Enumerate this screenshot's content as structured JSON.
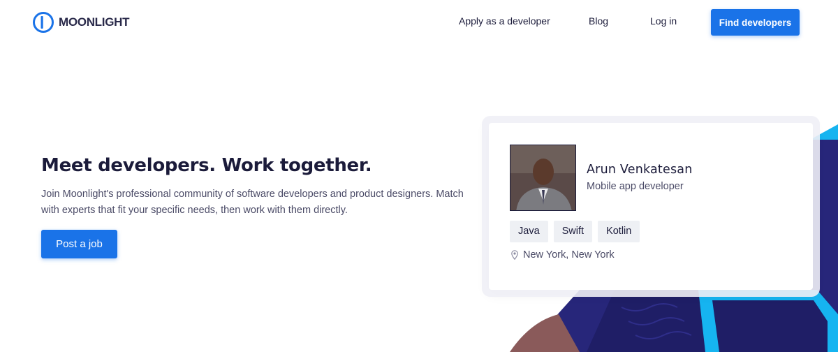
{
  "brand": {
    "name": "MOONLIGHT",
    "color": "#1a73e8"
  },
  "nav": {
    "apply": "Apply as a developer",
    "blog": "Blog",
    "login": "Log in",
    "find": "Find developers"
  },
  "hero": {
    "title": "Meet developers. Work together.",
    "subtitle": "Join Moonlight's professional community of software developers and product designers. Match with experts that fit your specific needs, then work with them directly.",
    "cta": "Post a job"
  },
  "profile": {
    "name": "Arun Venkatesan",
    "role": "Mobile app developer",
    "skills": [
      "Java",
      "Swift",
      "Kotlin"
    ],
    "location": "New York, New York",
    "icons": {
      "location": "map-pin-icon"
    }
  },
  "colors": {
    "primary": "#1a73e8",
    "text": "#1b1b3a",
    "muted": "#4a4a66",
    "tag_bg": "#eef0f4",
    "art_navy": "#27267a",
    "art_cyan": "#16b4f0",
    "art_brown": "#8a5a5a"
  }
}
